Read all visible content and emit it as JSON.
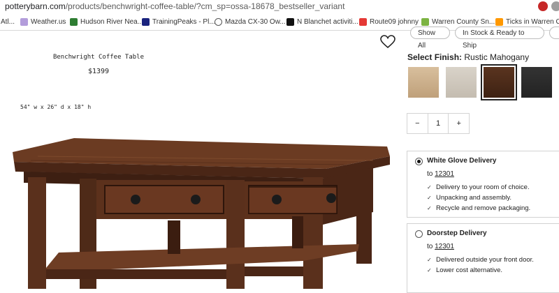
{
  "browser": {
    "url_host": "potterybarn.com",
    "url_path": "/products/benchwright-coffee-table/?cm_sp=ossa-18678_bestseller_variant",
    "bookmarks": [
      {
        "label": "Atl...",
        "icon": "globe-icon",
        "color": "#7a7a7a"
      },
      {
        "label": "Weather.us",
        "icon": "weather-icon",
        "color": "#8e7cc3"
      },
      {
        "label": "Hudson River Nea...",
        "icon": "river-icon",
        "color": "#2e7d32"
      },
      {
        "label": "TrainingPeaks - Pl...",
        "icon": "trainingpeaks-icon",
        "color": "#1a237e"
      },
      {
        "label": "Mazda CX-30 Ow...",
        "icon": "mazda-icon",
        "color": "#555555"
      },
      {
        "label": "N Blanchet activiti...",
        "icon": "blanchet-icon",
        "color": "#111111"
      },
      {
        "label": "Route09 johnny",
        "icon": "youtube-icon",
        "color": "#e53935"
      },
      {
        "label": "Warren County Sn...",
        "icon": "warren-icon",
        "color": "#7cb342"
      },
      {
        "label": "Ticks in Warren C...",
        "icon": "ticks-icon",
        "color": "#ff9800"
      }
    ]
  },
  "product": {
    "title": "Benchwright Coffee Table",
    "price": "$1399",
    "dimensions": "54\" w x 26\" d x 18\" h"
  },
  "filters": {
    "show_all": "Show All",
    "in_stock": "In Stock & Ready to Ship"
  },
  "finish": {
    "label": "Select Finish:",
    "selected": "Rustic Mahogany",
    "swatches": [
      {
        "name": "light-oak",
        "color": "#c9ad8a"
      },
      {
        "name": "whitewash",
        "color": "#cfc8bd"
      },
      {
        "name": "rustic-mahogany",
        "color": "#4a2a1a",
        "selected": true
      },
      {
        "name": "blackened",
        "color": "#2b2b2b"
      }
    ]
  },
  "quantity": {
    "minus": "−",
    "value": "1",
    "plus": "+"
  },
  "delivery": {
    "white_glove": {
      "title": "White Glove Delivery",
      "to": "to",
      "zip": "12301",
      "bullets": [
        "Delivery to your room of choice.",
        "Unpacking and assembly.",
        "Recycle and remove packaging."
      ]
    },
    "doorstep": {
      "title": "Doorstep Delivery",
      "to": "to",
      "zip": "12301",
      "bullets": [
        "Delivered outside your front door.",
        "Lower cost alternative."
      ]
    }
  }
}
